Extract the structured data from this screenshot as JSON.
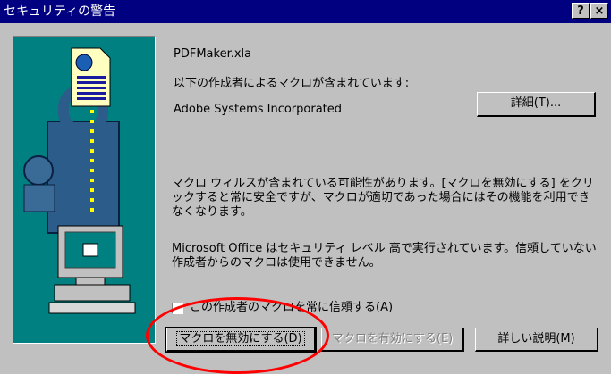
{
  "window": {
    "title": "セキュリティの警告",
    "help_label": "?",
    "close_label": "×"
  },
  "dialog": {
    "file_name": "PDFMaker.xla",
    "contains_macros_text": "以下の作成者によるマクロが含まれています:",
    "publisher": "Adobe Systems Incorporated",
    "details_button": "詳細(T)...",
    "warning_text": "マクロ ウィルスが含まれている可能性があります。[マクロを無効にする] をクリックすると常に安全ですが、マクロが適切であった場合にはその機能を利用できなくなります。",
    "security_level_text": "Microsoft Office はセキュリティ レベル 高で実行されています。信頼していない作成者からのマクロは使用できません。",
    "always_trust_label": "この作成者のマクロを常に信頼する(A)",
    "always_trust_checked": false
  },
  "buttons": {
    "disable_macros": "マクロを無効にする(D)",
    "enable_macros": "マクロを有効にする(E)",
    "more_info": "詳しい説明(M)"
  },
  "colors": {
    "titlebar": "#000080",
    "art_background": "#008080",
    "annotation": "#ff0000"
  }
}
